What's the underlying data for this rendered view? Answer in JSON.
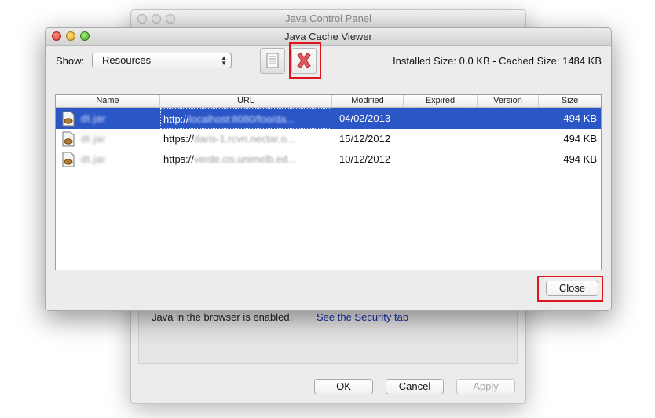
{
  "background_window": {
    "title": "Java Control Panel",
    "browser_status": "Java in the browser is enabled.",
    "security_link": "See the Security tab",
    "ok_label": "OK",
    "cancel_label": "Cancel",
    "apply_label": "Apply"
  },
  "dialog": {
    "title": "Java Cache Viewer",
    "show_label": "Show:",
    "show_value": "Resources",
    "installed_size": "Installed Size:  0.0 KB - Cached Size:  1484 KB",
    "close_label": "Close",
    "table": {
      "columns": [
        "Name",
        "URL",
        "Modified",
        "Expired",
        "Version",
        "Size"
      ],
      "rows": [
        {
          "name": "dt.jar",
          "url_start": "http://",
          "url_rest": "localhost:8080/foo/da...",
          "modified": "04/02/2013",
          "expired": "",
          "version": "",
          "size": "494 KB",
          "selected": true
        },
        {
          "name": "dt.jar",
          "url_start": "https://",
          "url_rest": "daris-1.rcvn.nectar.o...",
          "modified": "15/12/2012",
          "expired": "",
          "version": "",
          "size": "494 KB",
          "selected": false
        },
        {
          "name": "dt.jar",
          "url_start": "https://",
          "url_rest": "verde.cis.unimelb.ed...",
          "modified": "10/12/2012",
          "expired": "",
          "version": "",
          "size": "494 KB",
          "selected": false
        }
      ]
    }
  },
  "icons": {
    "traffic": [
      "close-dot",
      "minimize-dot",
      "zoom-dot"
    ],
    "toolbar": [
      "document-icon",
      "delete-x-icon"
    ],
    "row": "jar-file-icon"
  },
  "colors": {
    "selection": "#2b57c6",
    "highlight": "#e0141e",
    "link": "#1a2fb0"
  }
}
